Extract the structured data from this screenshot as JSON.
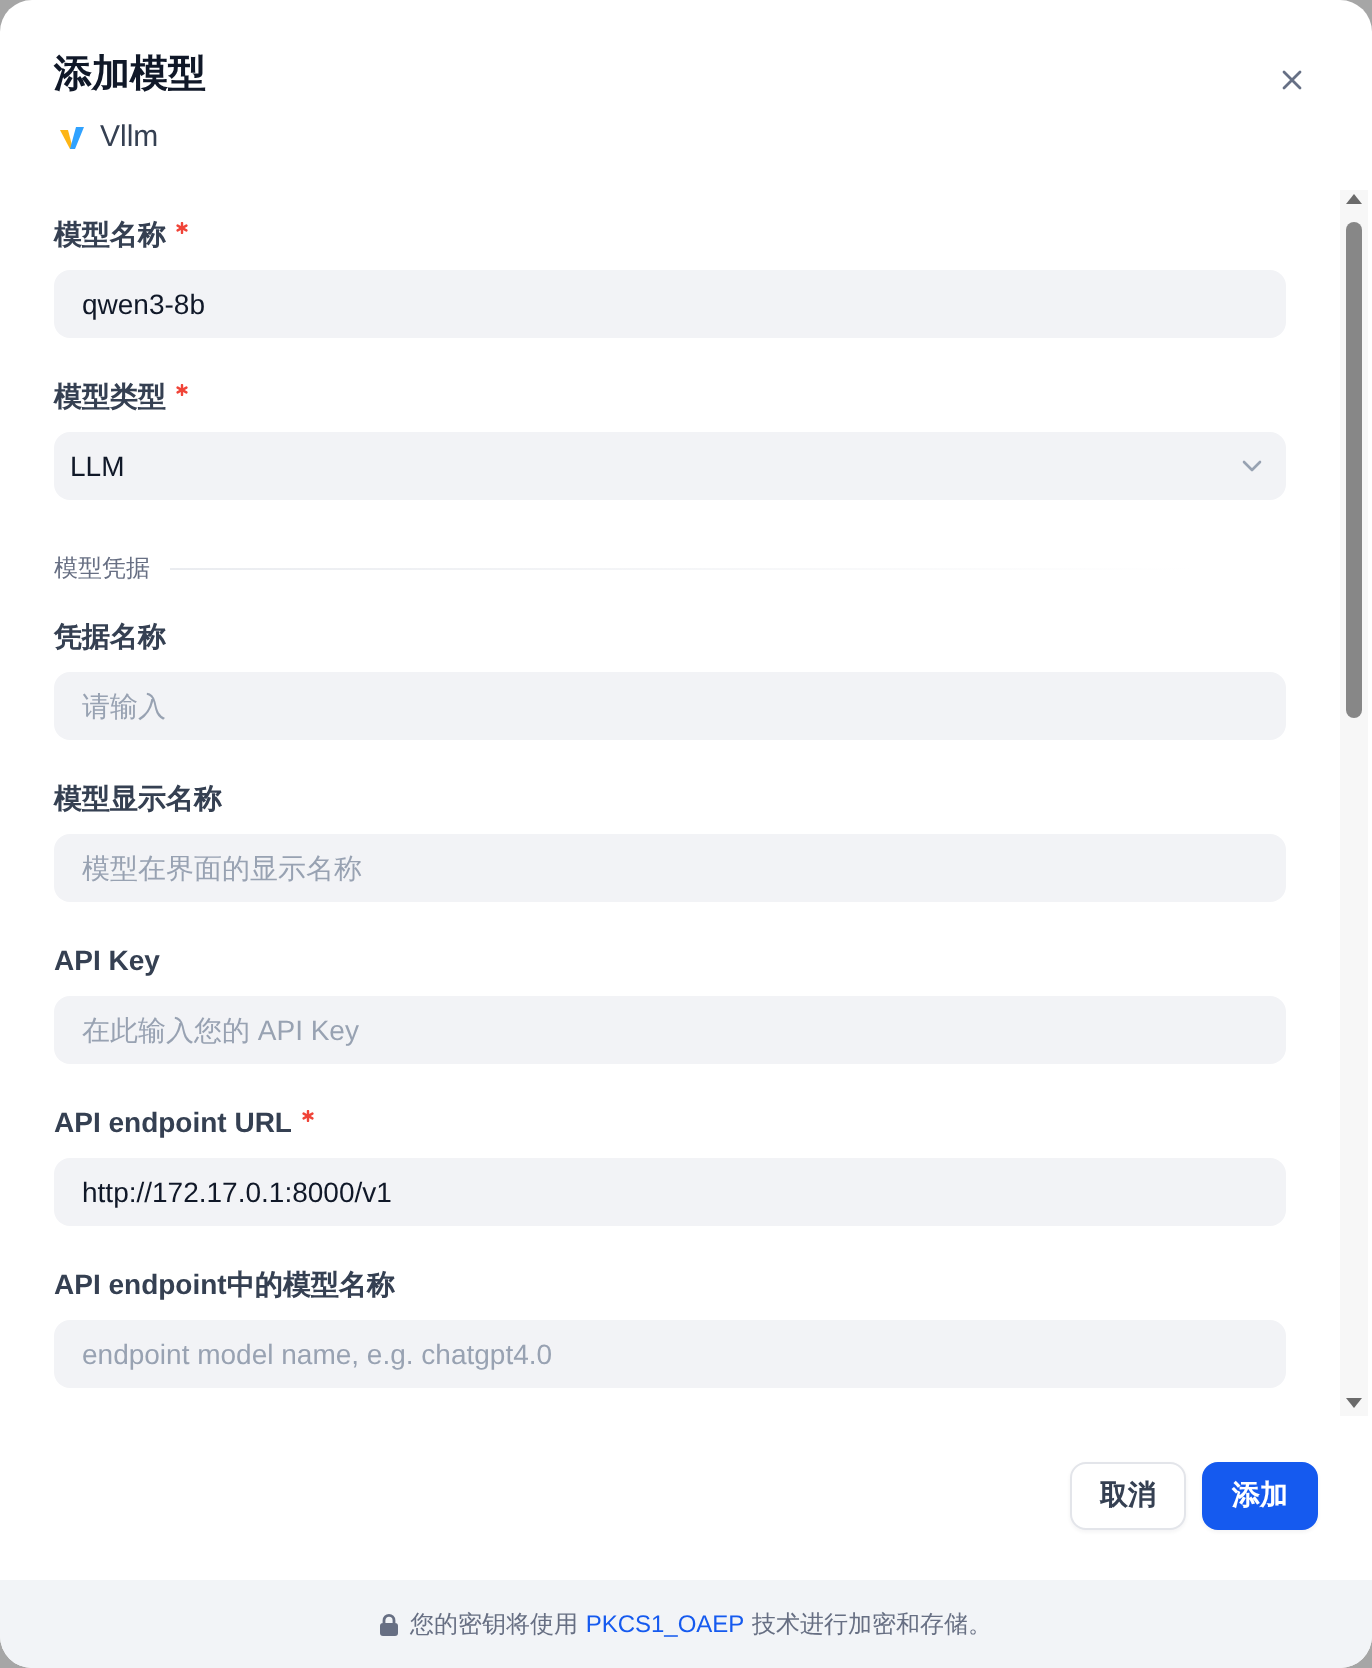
{
  "dialog": {
    "title": "添加模型",
    "provider": {
      "name": "Vllm"
    }
  },
  "fields": [
    {
      "label": "模型名称",
      "required": true,
      "kind": "input",
      "value": "qwen3-8b"
    },
    {
      "label": "模型类型",
      "required": true,
      "kind": "select",
      "value": "LLM"
    }
  ],
  "section": {
    "title": "模型凭据"
  },
  "credential_fields": [
    {
      "label": "凭据名称",
      "required": false,
      "kind": "input",
      "placeholder": "请输入"
    },
    {
      "label": "模型显示名称",
      "required": false,
      "kind": "input",
      "placeholder": "模型在界面的显示名称"
    },
    {
      "label": "API Key",
      "required": false,
      "kind": "input",
      "placeholder": "在此输入您的 API Key"
    },
    {
      "label": "API endpoint URL",
      "required": true,
      "kind": "input",
      "value": "http://172.17.0.1:8000/v1"
    },
    {
      "label": "API endpoint中的模型名称",
      "required": false,
      "kind": "input",
      "placeholder": "endpoint model name, e.g. chatgpt4.0"
    }
  ],
  "buttons": [
    {
      "label": "取消",
      "kind": "secondary"
    },
    {
      "label": "添加",
      "kind": "primary"
    }
  ],
  "footer": {
    "text_before": "您的密钥将使用",
    "link": "PKCS1_OAEP",
    "text_after": "技术进行加密和存储。"
  }
}
